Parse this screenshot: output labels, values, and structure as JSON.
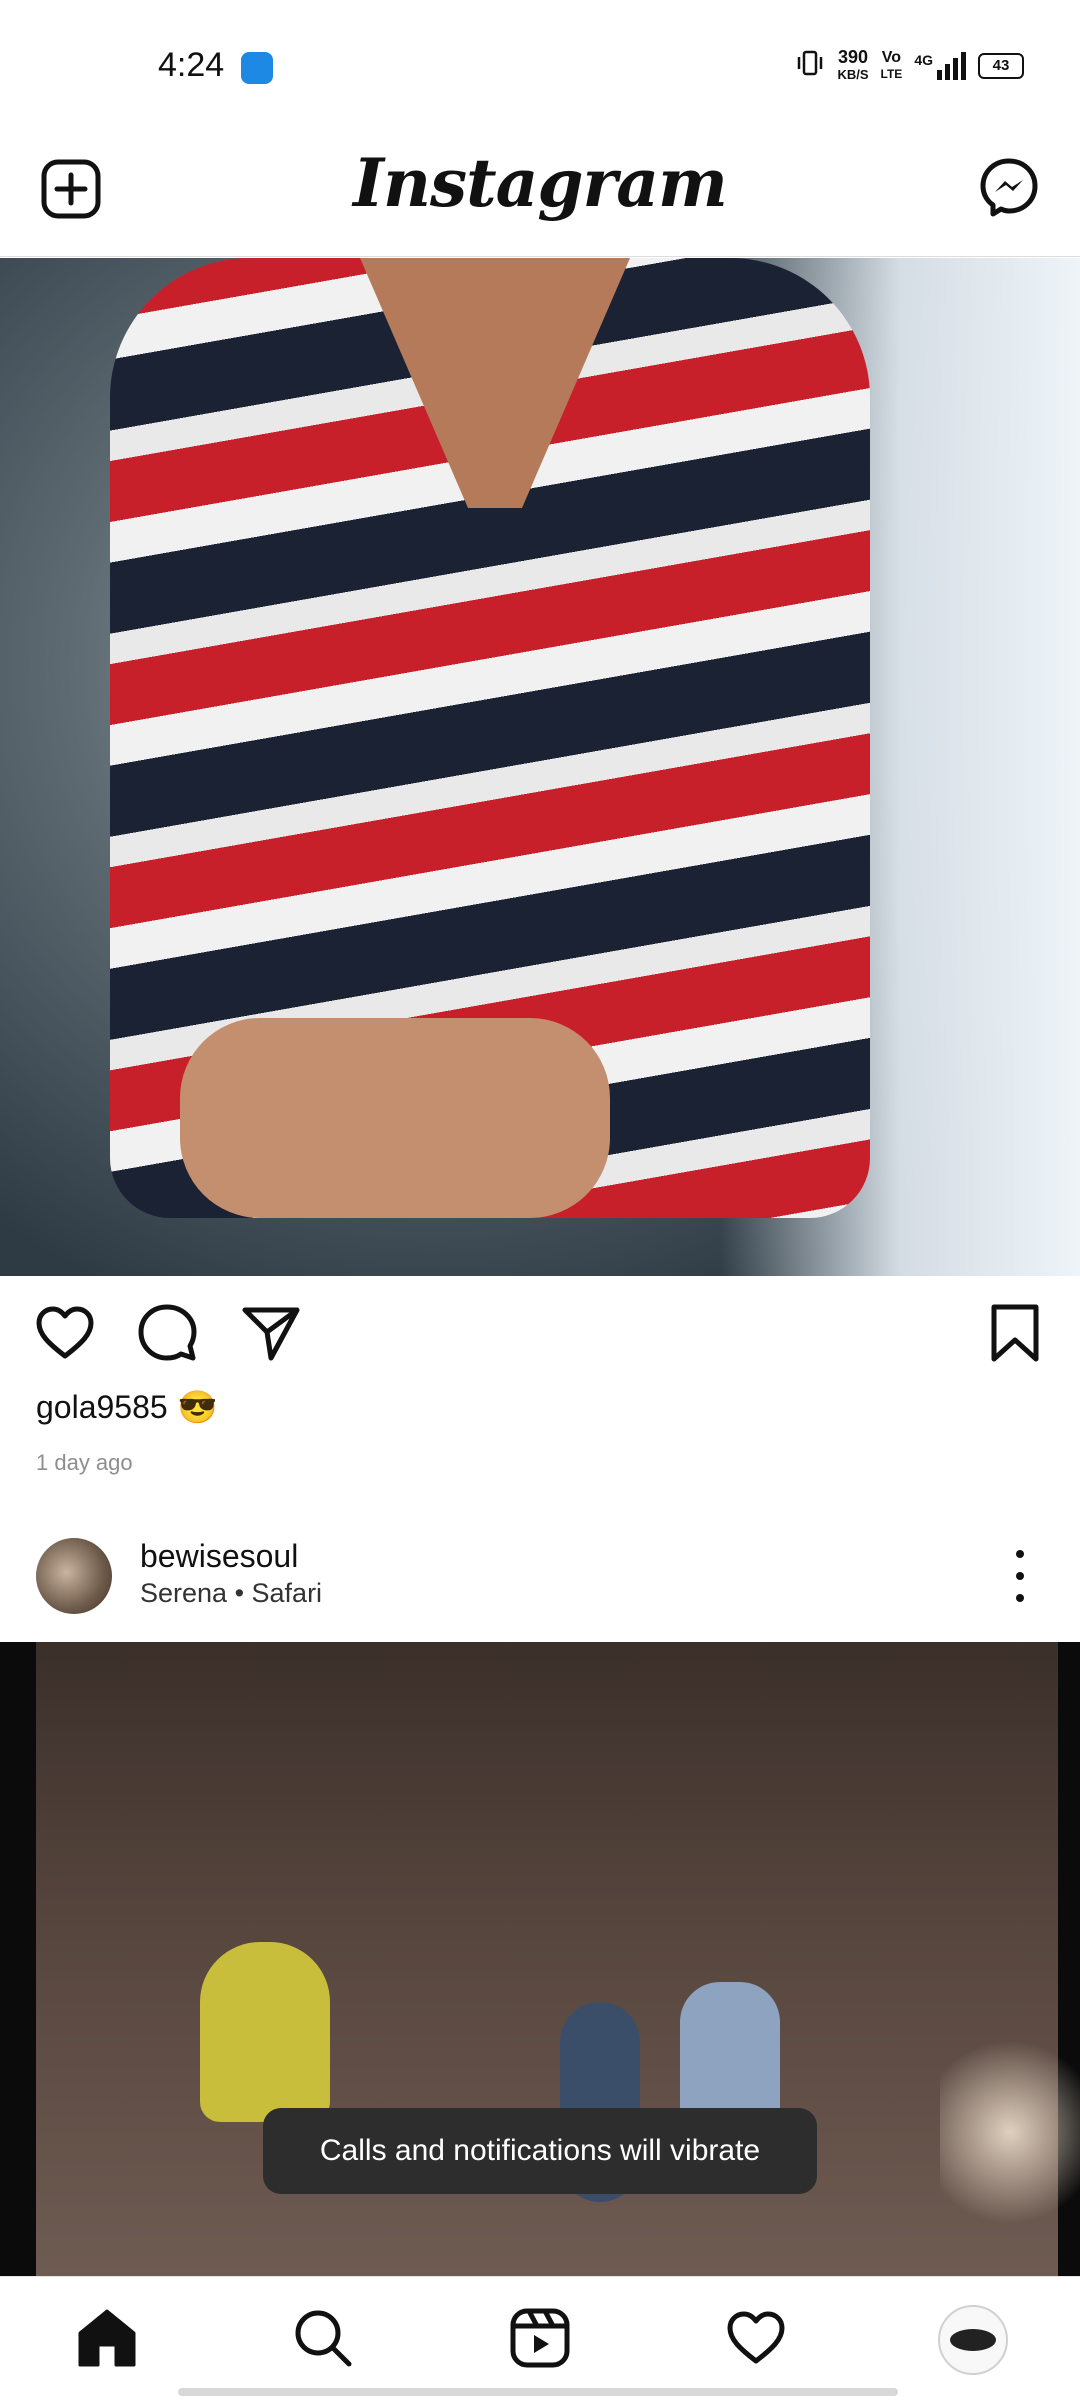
{
  "status_bar": {
    "time": "4:24",
    "net_speed_value": "390",
    "net_speed_unit": "KB/S",
    "volte_top": "Vo",
    "volte_bottom": "LTE",
    "network": "4G",
    "battery": "43"
  },
  "header": {
    "logo": "Instagram",
    "add_icon": "plus-square-icon",
    "messenger_icon": "messenger-icon"
  },
  "post1": {
    "username": "gola9585",
    "emoji": "😎",
    "time_ago": "1 day ago",
    "actions": [
      "heart-icon",
      "comment-icon",
      "share-icon",
      "bookmark-icon"
    ]
  },
  "post2": {
    "username": "bewisesoul",
    "subline": "Serena • Safari"
  },
  "toast": {
    "message": "Calls and notifications will vibrate"
  },
  "bottom_nav": {
    "items": [
      "home-icon",
      "search-icon",
      "reels-icon",
      "activity-heart-icon",
      "profile-avatar"
    ]
  },
  "colors": {
    "background": "#ffffff",
    "text": "#111111",
    "muted": "#8e8e8e",
    "toast_bg": "#2d2d2d",
    "accent_blue": "#1e88e5"
  }
}
